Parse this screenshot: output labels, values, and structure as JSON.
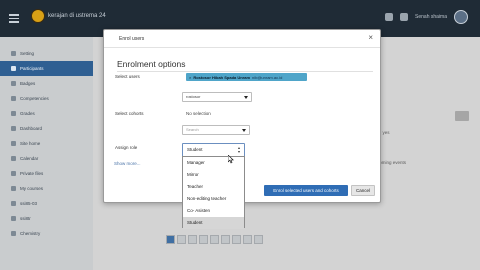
{
  "navbar": {
    "site_name": "kerajan di ustrema 24",
    "user_name": "Senah shaima"
  },
  "drawer": {
    "items": [
      {
        "label": "Setting"
      },
      {
        "label": "Participants"
      },
      {
        "label": "Badges"
      },
      {
        "label": "Competencies"
      },
      {
        "label": "Grades"
      },
      {
        "label": "Dashboard"
      },
      {
        "label": "Site home"
      },
      {
        "label": "Calendar"
      },
      {
        "label": "Private files"
      },
      {
        "label": "My courses"
      },
      {
        "label": "ssi85-03"
      },
      {
        "label": "ssi8tr"
      },
      {
        "label": "Chemistry"
      }
    ]
  },
  "background": {
    "right_texts": [
      "participants",
      "Enrolled users",
      "have been pruned yes",
      "Upcoming events",
      "There are no upcoming events",
      "Go to calendar..."
    ]
  },
  "modal": {
    "title": "Enrol users",
    "close_glyph": "×",
    "section_title": "Enrolment options",
    "select_users_label": "Select users",
    "selected_user": {
      "remove_glyph": "×",
      "name": "Rostosor Hibah Spada Unram",
      "email": "nib@unram.ac.id"
    },
    "users_search_value": "rostosor",
    "select_cohorts_label": "Select cohorts",
    "cohorts_status": "No selection",
    "cohorts_search_placeholder": "Search",
    "assign_role_label": "Assign role",
    "assign_role_value": "Student",
    "role_options": [
      {
        "label": "Manager",
        "selected": false
      },
      {
        "label": "Mirror",
        "selected": false
      },
      {
        "label": "Teacher",
        "selected": false
      },
      {
        "label": "Non-editing teacher",
        "selected": false
      },
      {
        "label": "Co- Asisten",
        "selected": false
      },
      {
        "label": "Student",
        "selected": true
      }
    ],
    "show_more": "Show more...",
    "submit_label": "Enrol selected users and cohorts",
    "cancel_label": "Cancel"
  },
  "colors": {
    "navbar": "#1f2b36",
    "drawer_active": "#2f5f92",
    "chip": "#4fa5c9",
    "primary_button": "#2f6db5"
  }
}
